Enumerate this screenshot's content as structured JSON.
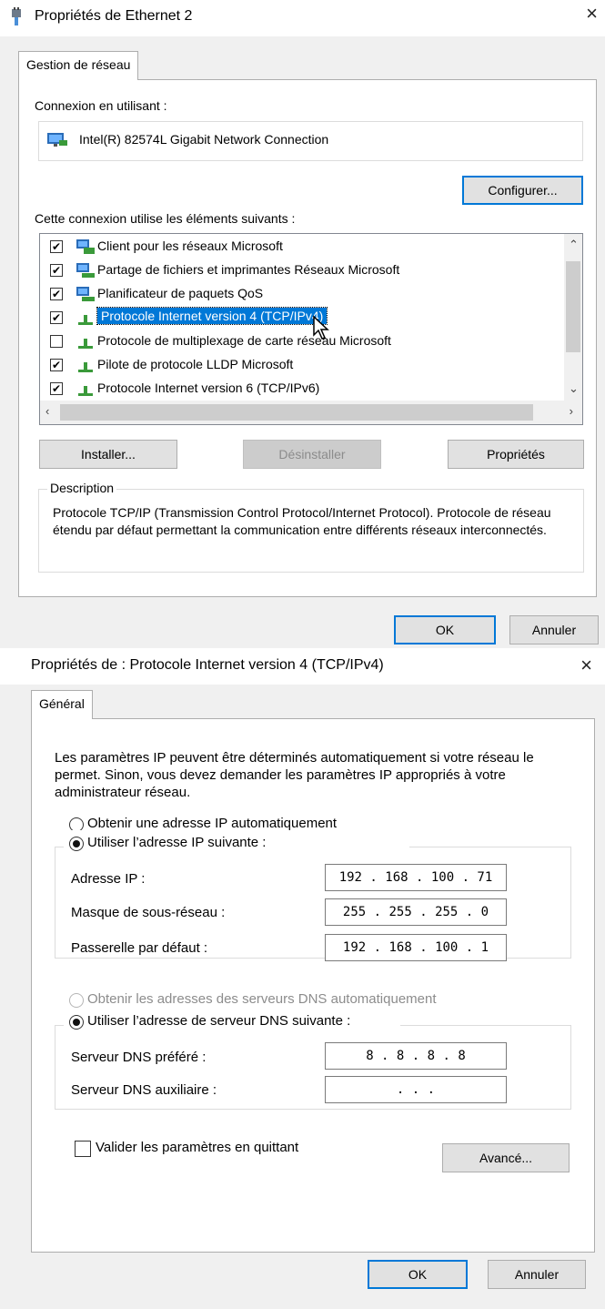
{
  "ethernet_dialog": {
    "title": "Propriétés de Ethernet 2",
    "close_glyph": "×",
    "tab_label": "Gestion de réseau",
    "connect_using_label": "Connexion en utilisant :",
    "adapter_name": "Intel(R) 82574L Gigabit Network Connection",
    "configure_label": "Configurer...",
    "items_label": "Cette connexion utilise les éléments suivants :",
    "items": [
      {
        "label": "Client pour les réseaux Microsoft",
        "checked": true,
        "icon": "network-client-icon"
      },
      {
        "label": "Partage de fichiers et imprimantes Réseaux Microsoft",
        "checked": true,
        "icon": "network-service-icon"
      },
      {
        "label": "Planificateur de paquets QoS",
        "checked": true,
        "icon": "network-service-icon"
      },
      {
        "label": "Protocole Internet version 4 (TCP/IPv4)",
        "checked": true,
        "icon": "protocol-icon",
        "selected": true
      },
      {
        "label": "Protocole de multiplexage de carte réseau Microsoft",
        "checked": false,
        "icon": "protocol-icon"
      },
      {
        "label": "Pilote de protocole LLDP Microsoft",
        "checked": true,
        "icon": "protocol-icon"
      },
      {
        "label": "Protocole Internet version 6 (TCP/IPv6)",
        "checked": true,
        "icon": "protocol-icon"
      }
    ],
    "install_label": "Installer...",
    "uninstall_label": "Désinstaller",
    "properties_label": "Propriétés",
    "description_legend": "Description",
    "description_text": "Protocole TCP/IP (Transmission Control Protocol/Internet Protocol). Protocole de réseau étendu par défaut permettant la communication entre différents réseaux interconnectés.",
    "ok_label": "OK",
    "cancel_label": "Annuler"
  },
  "ipv4_dialog": {
    "title": "Propriétés de : Protocole Internet version 4 (TCP/IPv4)",
    "close_glyph": "×",
    "tab_label": "Général",
    "intro_text": "Les paramètres IP peuvent être déterminés automatiquement si votre réseau le permet. Sinon, vous devez demander les paramètres IP appropriés à votre administrateur réseau.",
    "auto_ip_label": "Obtenir une adresse IP automatiquement",
    "manual_ip_label": "Utiliser l’adresse IP suivante :",
    "ip_address_label": "Adresse IP :",
    "ip_address_value": "192 . 168 . 100 . 71",
    "subnet_label": "Masque de sous-réseau :",
    "subnet_value": "255 . 255 . 255 .  0",
    "gateway_label": "Passerelle par défaut :",
    "gateway_value": "192 . 168 . 100 .  1",
    "auto_dns_label": "Obtenir les adresses des serveurs DNS automatiquement",
    "manual_dns_label": "Utiliser l’adresse de serveur DNS suivante :",
    "preferred_dns_label": "Serveur DNS préféré :",
    "preferred_dns_value": "8  .  8  .  8  .  8",
    "alternate_dns_label": "Serveur DNS auxiliaire :",
    "alternate_dns_value": ".        .        .",
    "validate_label": "Valider les paramètres en quittant",
    "advanced_label": "Avancé...",
    "ok_label": "OK",
    "cancel_label": "Annuler"
  }
}
